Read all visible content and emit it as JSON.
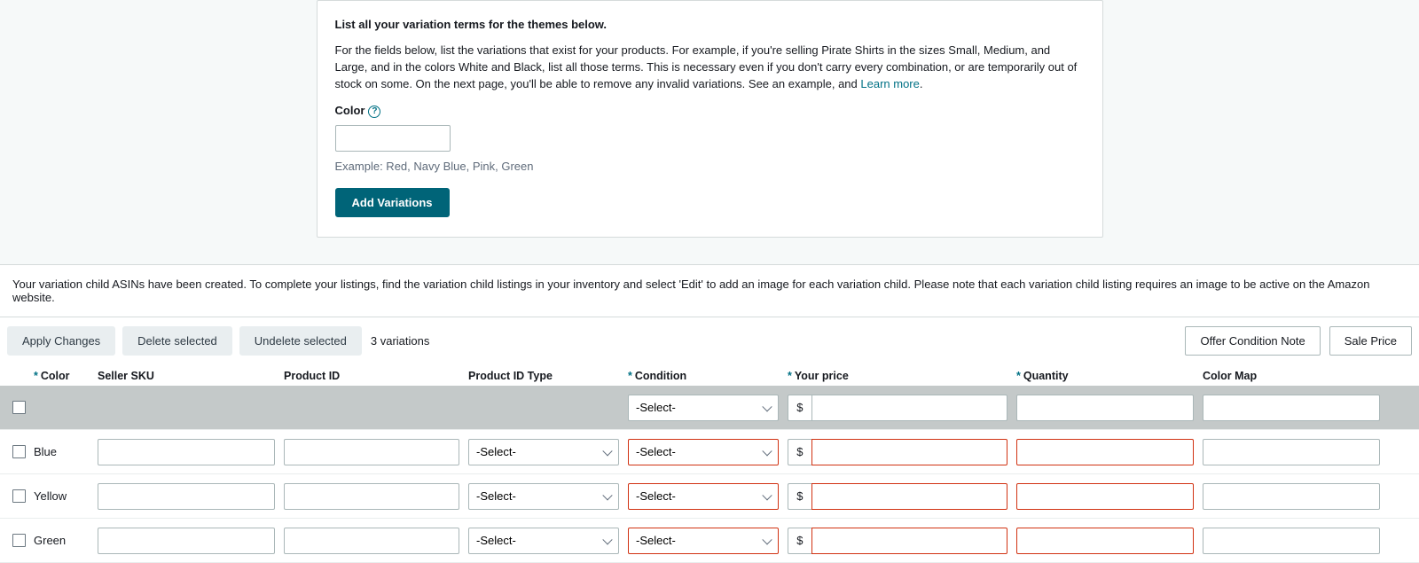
{
  "panel": {
    "heading": "List all your variation terms for the themes below.",
    "body_a": "For the fields below, list the variations that exist for your products. For example, if you're selling Pirate Shirts in the sizes Small, Medium, and Large, and in the colors White and Black, list all those terms. This is necessary even if you don't carry every combination, or are temporarily out of stock on some. On the next page, you'll be able to remove any invalid variations. See an example, and ",
    "learn_more": "Learn more",
    "color_label": "Color",
    "help_glyph": "?",
    "color_value": "",
    "example": "Example: Red, Navy Blue, Pink, Green",
    "add_btn": "Add Variations"
  },
  "info_bar": "Your variation child ASINs have been created. To complete your listings, find the variation child listings in your inventory and select 'Edit' to add an image for each variation child. Please note that each variation child listing requires an image to be active on the Amazon website.",
  "toolbar": {
    "apply": "Apply Changes",
    "delete": "Delete selected",
    "undelete": "Undelete selected",
    "count": "3 variations",
    "offer_note": "Offer Condition Note",
    "sale_price": "Sale Price"
  },
  "headers": {
    "color": "Color",
    "sku": "Seller SKU",
    "pid": "Product ID",
    "pid_type": "Product ID Type",
    "condition": "Condition",
    "price": "Your price",
    "qty": "Quantity",
    "color_map": "Color Map"
  },
  "select_placeholder": "-Select-",
  "currency": "$",
  "rows": [
    {
      "color": "Blue"
    },
    {
      "color": "Yellow"
    },
    {
      "color": "Green"
    }
  ]
}
